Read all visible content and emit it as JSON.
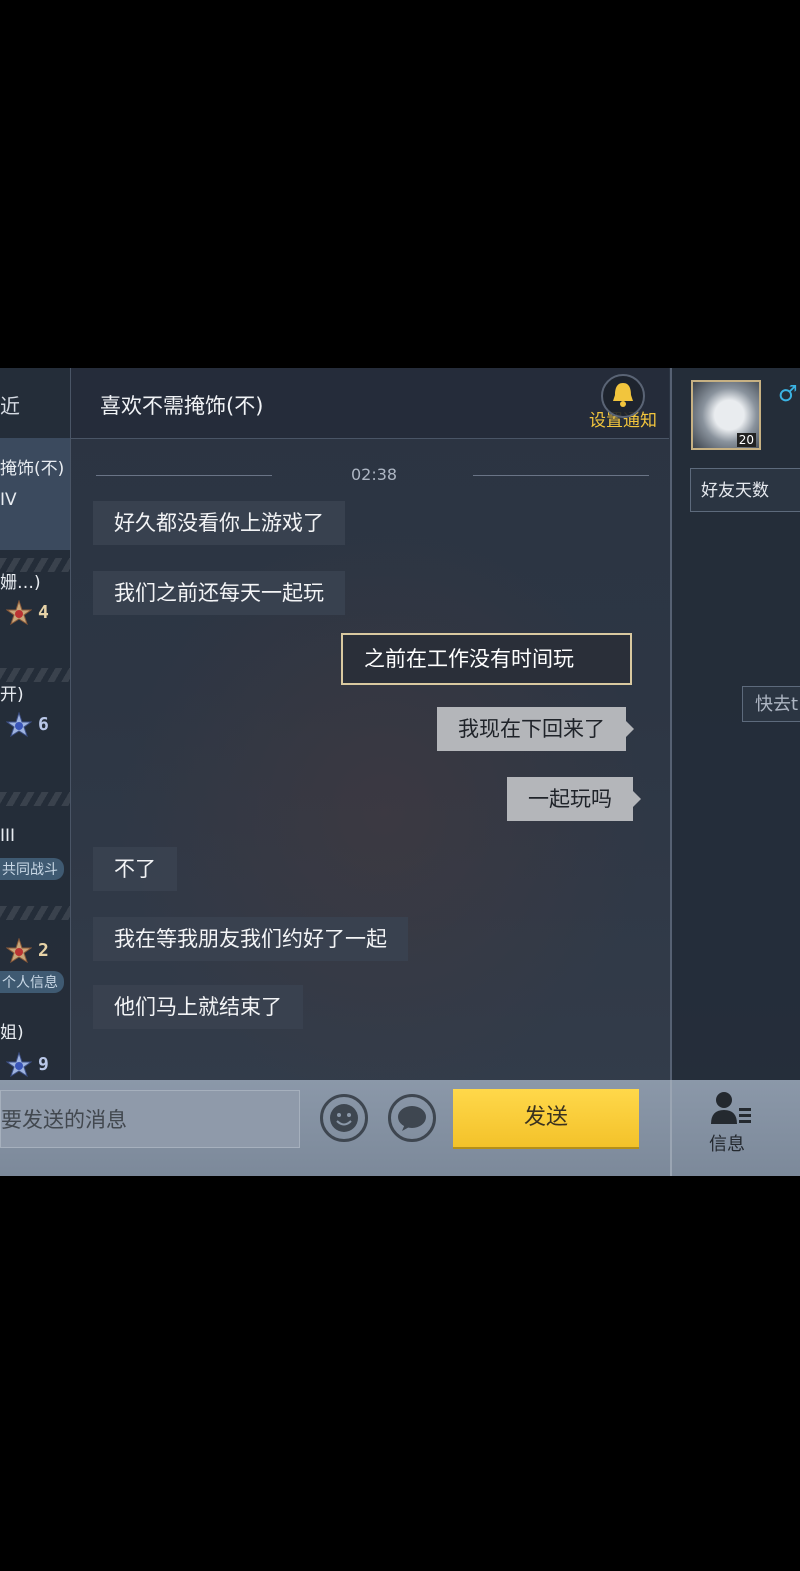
{
  "left_list": {
    "tab_recent": "近",
    "items": [
      {
        "line1": "掩饰(不)",
        "line2": "IV"
      },
      {
        "line1": "姗…)",
        "rank": "4"
      },
      {
        "line1": "开)",
        "rank": "6"
      },
      {
        "line1": "III",
        "badge": "共同战斗"
      },
      {
        "rank": "2",
        "badge": "个人信息"
      },
      {
        "line1": "姐)",
        "rank": "9"
      }
    ]
  },
  "header": {
    "title": "喜欢不需掩饰(不)",
    "notify_label": "设置通知",
    "bell_icon": "bell-icon"
  },
  "chat": {
    "timestamp": "02:38",
    "messages": [
      {
        "side": "in",
        "text": "好久都没看你上游戏了"
      },
      {
        "side": "in",
        "text": "我们之前还每天一起玩"
      },
      {
        "side": "out",
        "text": "之前在工作没有时间玩",
        "style": "special"
      },
      {
        "side": "out",
        "text": "我现在下回来了"
      },
      {
        "side": "out",
        "text": "一起玩吗"
      },
      {
        "side": "in",
        "text": "不了"
      },
      {
        "side": "in",
        "text": "我在等我朋友我们约好了一起"
      },
      {
        "side": "in",
        "text": "他们马上就结束了"
      }
    ]
  },
  "right_panel": {
    "avatar_level": "20",
    "gender": "♂",
    "friend_days_label": "好友天数",
    "quick_label": "快去t"
  },
  "bottom_bar": {
    "input_placeholder": "要发送的消息",
    "emoji_icon": "emoji-icon",
    "voice_icon": "speech-bubble-icon",
    "send_label": "发送",
    "info_label": "信息"
  },
  "colors": {
    "accent_yellow": "#f3c22a",
    "notify_text": "#f2c53d",
    "gender_blue": "#3bb3e3"
  }
}
